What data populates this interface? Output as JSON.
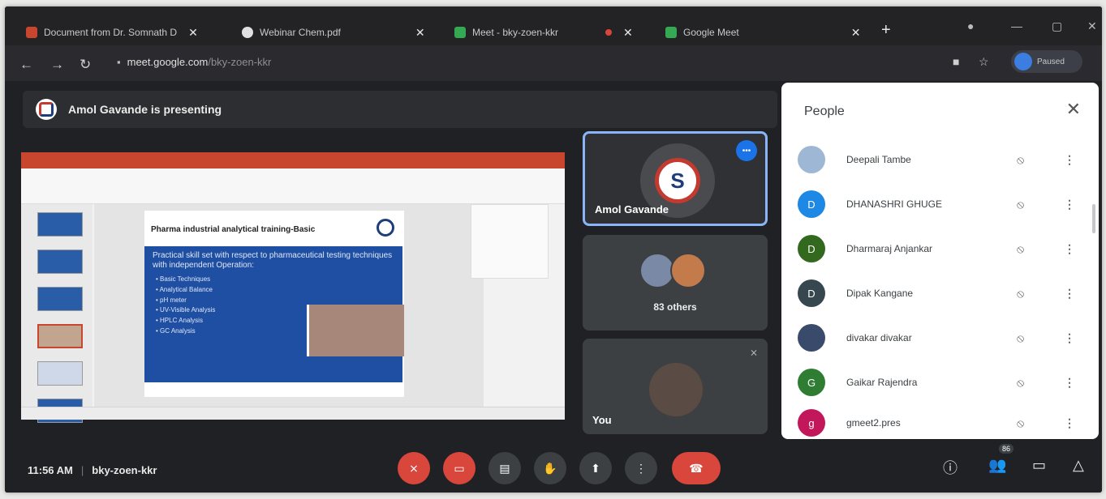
{
  "browser": {
    "tabs": [
      {
        "label": "Document from Dr. Somnath D",
        "icon": "docs-icon",
        "color": "#c9462e"
      },
      {
        "label": "Webinar Chem.pdf",
        "icon": "globe-icon",
        "color": "#e0e0e0"
      },
      {
        "label": "Meet - bky-zoen-kkr",
        "icon": "meet-icon",
        "color": "#34a853"
      },
      {
        "label": "Google Meet",
        "icon": "meet-icon",
        "color": "#34a853"
      }
    ],
    "new_tab": "+",
    "url_host": "meet.google.com",
    "url_path": "/bky-zoen-kkr",
    "profile_label": "Paused"
  },
  "meeting": {
    "presenting_text": "Amol Gavande is presenting",
    "code": "bky-zoen-kkr",
    "time": "11:56 AM",
    "participant_count": "86"
  },
  "slide": {
    "title": "Pharma industrial analytical training-Basic",
    "lead": "Practical skill set with respect to pharmaceutical testing techniques with independent Operation:",
    "bullets": [
      "Basic Techniques",
      "Analytical Balance",
      "pH meter",
      "UV-Visible Analysis",
      "HPLC Analysis",
      "GC Analysis"
    ]
  },
  "tiles": {
    "presenter_name": "Amol Gavande",
    "others_label": "83 others",
    "self_label": "You"
  },
  "people": {
    "title": "People",
    "list": [
      {
        "name": "Deepali Tambe",
        "initial": "",
        "color": "#9db7d4"
      },
      {
        "name": "DHANASHRI GHUGE",
        "initial": "D",
        "color": "#1e88e5"
      },
      {
        "name": "Dharmaraj Anjankar",
        "initial": "D",
        "color": "#33691e"
      },
      {
        "name": "Dipak Kangane",
        "initial": "D",
        "color": "#37474f"
      },
      {
        "name": "divakar divakar",
        "initial": "",
        "color": "#3a4a6a"
      },
      {
        "name": "Gaikar Rajendra",
        "initial": "G",
        "color": "#2e7d32"
      },
      {
        "name": "gmeet2.pres",
        "initial": "g",
        "color": "#c2185b"
      }
    ]
  }
}
